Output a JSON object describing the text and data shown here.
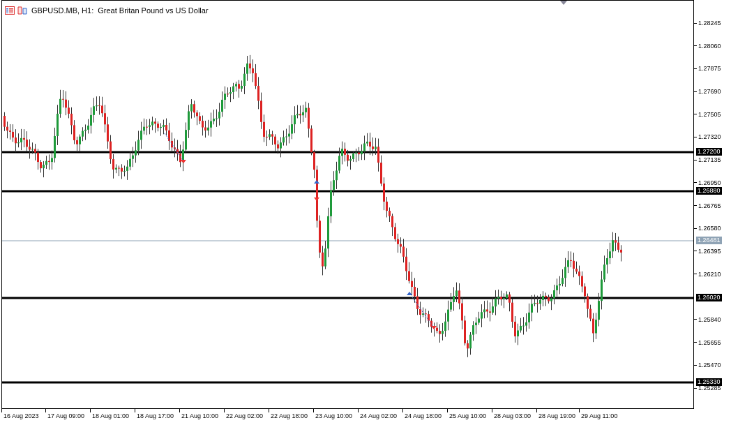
{
  "chart": {
    "symbol": "GBPUSD.MB, H1:",
    "description": "Great Britan Pound vs US Dollar"
  },
  "price_axis": [
    "1.28245",
    "1.28060",
    "1.27875",
    "1.27690",
    "1.27505",
    "1.27320",
    "1.27135",
    "1.26950",
    "1.26765",
    "1.26580",
    "1.26395",
    "1.26210",
    "1.25840",
    "1.25655",
    "1.25470",
    "1.25285"
  ],
  "level_lines": [
    {
      "label": "1.27200",
      "kind": "level"
    },
    {
      "label": "1.26880",
      "kind": "level"
    },
    {
      "label": "1.26481",
      "kind": "bid"
    },
    {
      "label": "1.26020",
      "kind": "level"
    },
    {
      "label": "1.25330",
      "kind": "level"
    }
  ],
  "time_axis": [
    "16 Aug 2023",
    "17 Aug 09:00",
    "18 Aug 01:00",
    "18 Aug 17:00",
    "21 Aug 10:00",
    "22 Aug 02:00",
    "22 Aug 18:00",
    "23 Aug 10:00",
    "24 Aug 02:00",
    "24 Aug 18:00",
    "25 Aug 10:00",
    "28 Aug 03:00",
    "28 Aug 19:00",
    "29 Aug 11:00"
  ]
}
